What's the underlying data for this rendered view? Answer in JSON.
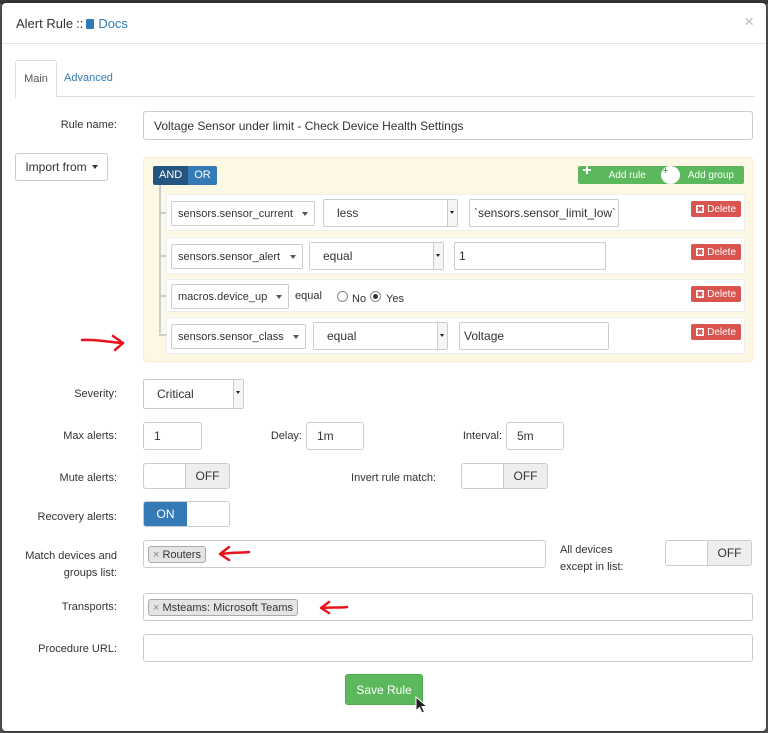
{
  "modal": {
    "title": "Alert Rule",
    "separator": "::",
    "docs_label": "Docs",
    "close_glyph": "×"
  },
  "tabs": [
    {
      "label": "Main",
      "active": true
    },
    {
      "label": "Advanced",
      "active": false
    }
  ],
  "rule_name": {
    "label": "Rule name:",
    "value": "Voltage Sensor under limit - Check Device Health Settings"
  },
  "import_from": {
    "label": "Import from"
  },
  "builder": {
    "and_label": "AND",
    "or_label": "OR",
    "add_rule_label": "Add rule",
    "add_group_label": "Add group",
    "rules": [
      {
        "field": "sensors.sensor_current",
        "operator": "less",
        "value": "`sensors.sensor_limit_low`",
        "delete_label": "Delete"
      },
      {
        "field": "sensors.sensor_alert",
        "operator": "equal",
        "value": "1",
        "delete_label": "Delete"
      },
      {
        "field": "macros.device_up",
        "operator": "equal",
        "radio_no": "No",
        "radio_yes": "Yes",
        "selected": "Yes",
        "delete_label": "Delete"
      },
      {
        "field": "sensors.sensor_class",
        "operator": "equal",
        "value": "Voltage",
        "delete_label": "Delete"
      }
    ]
  },
  "severity": {
    "label": "Severity:",
    "value": "Critical"
  },
  "max_alerts": {
    "label": "Max alerts:",
    "value": "1"
  },
  "delay": {
    "label": "Delay:",
    "value": "1m"
  },
  "interval": {
    "label": "Interval:",
    "value": "5m"
  },
  "mute_alerts": {
    "label": "Mute alerts:",
    "state": "OFF"
  },
  "invert_rule_match": {
    "label": "Invert rule match:",
    "state": "OFF"
  },
  "recovery_alerts": {
    "label": "Recovery alerts:",
    "state": "ON"
  },
  "match_devices": {
    "label_line1": "Match devices and",
    "label_line2": "groups list:",
    "tags": [
      "Routers"
    ],
    "tag_remove_glyph": "×"
  },
  "all_devices": {
    "label_line1": "All devices",
    "label_line2": "except in list:",
    "state": "OFF"
  },
  "transports": {
    "label": "Transports:",
    "tags": [
      "Msteams: Microsoft Teams"
    ],
    "tag_remove_glyph": "×"
  },
  "procedure_url": {
    "label": "Procedure URL:",
    "value": ""
  },
  "save_button": {
    "label": "Save Rule"
  },
  "colors": {
    "primary": "#337ab7",
    "success": "#5cb85c",
    "danger": "#d9534f",
    "builder_bg": "#fcf8e3",
    "annotation_arrow": "#e8141b"
  }
}
